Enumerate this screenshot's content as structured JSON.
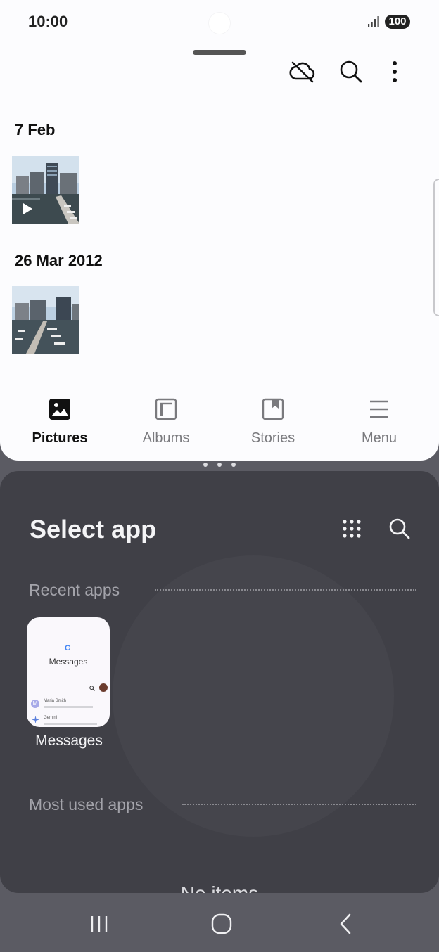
{
  "status_bar": {
    "time": "10:00",
    "battery": "100"
  },
  "gallery": {
    "sections": [
      {
        "date": "7 Feb",
        "has_video": true
      },
      {
        "date": "26 Mar 2012",
        "has_video": false
      }
    ],
    "nav": [
      {
        "label": "Pictures",
        "icon": "pictures-icon",
        "active": true
      },
      {
        "label": "Albums",
        "icon": "albums-icon",
        "active": false
      },
      {
        "label": "Stories",
        "icon": "stories-icon",
        "active": false
      },
      {
        "label": "Menu",
        "icon": "menu-icon",
        "active": false
      }
    ]
  },
  "select_app": {
    "title": "Select app",
    "recent_label": "Recent apps",
    "recent_apps": [
      {
        "name": "Messages",
        "preview_title": "Messages",
        "preview_rows": [
          "Maria Smith",
          "Gemini"
        ]
      }
    ],
    "most_used_label": "Most used apps",
    "empty_text": "No items"
  },
  "colors": {
    "accent_dark": "#404047",
    "top_bg": "#fcfcfe"
  }
}
